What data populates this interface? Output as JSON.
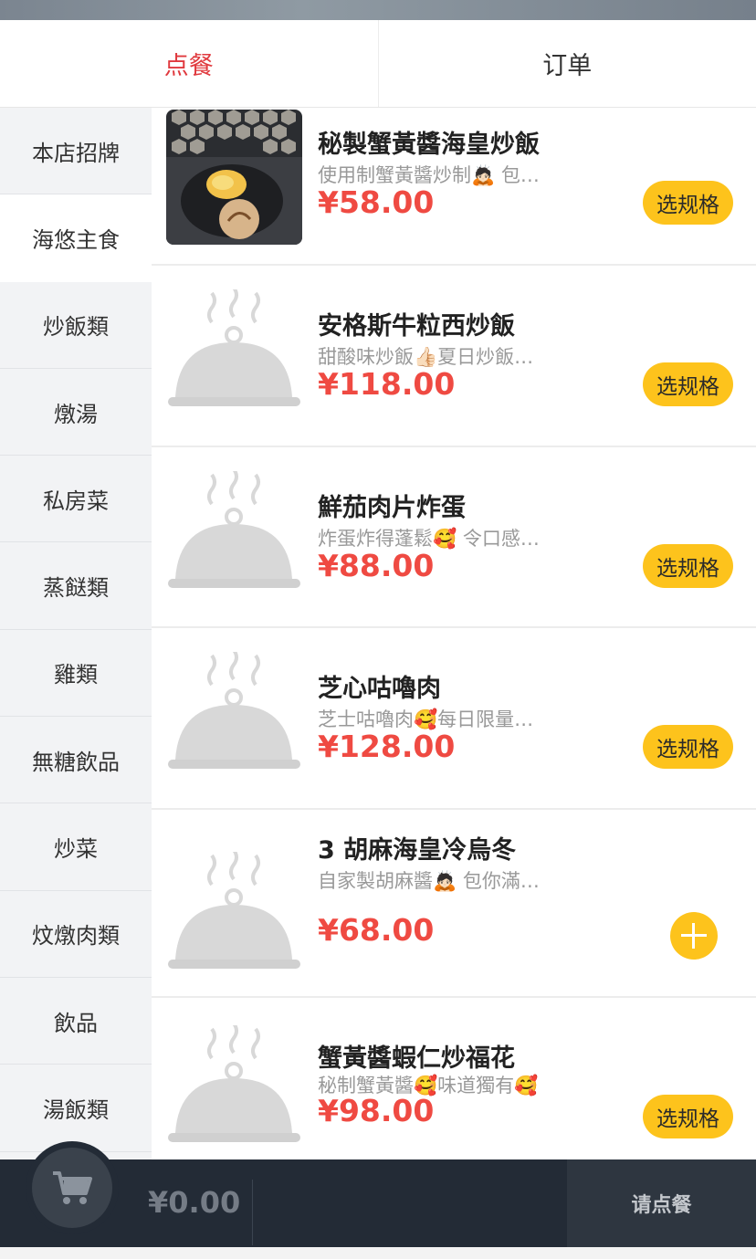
{
  "tabs": [
    {
      "label": "点餐",
      "active": true
    },
    {
      "label": "订单",
      "active": false
    }
  ],
  "sidebar": {
    "items": [
      {
        "label": "本店招牌"
      },
      {
        "label": "海悠主食"
      },
      {
        "label": "炒飯類"
      },
      {
        "label": "燉湯"
      },
      {
        "label": "私房菜"
      },
      {
        "label": "蒸餸類"
      },
      {
        "label": "雞類"
      },
      {
        "label": "無糖飲品"
      },
      {
        "label": "炒菜"
      },
      {
        "label": "炆燉肉類"
      },
      {
        "label": "飲品"
      },
      {
        "label": "湯飯類"
      }
    ],
    "active_index": 1
  },
  "dishes": [
    {
      "name": "秘製蟹黃醬海皇炒飯",
      "desc": "使用制蟹黃醬炒制🙇🏻 包…",
      "price": "¥58.00",
      "action": "选规格",
      "image": "photo"
    },
    {
      "name": "安格斯牛粒西炒飯",
      "desc": "甜酸味炒飯👍🏻夏日炒飯…",
      "price": "¥118.00",
      "action": "选规格",
      "image": "placeholder-cloche-icon"
    },
    {
      "name": "鮮茄肉片炸蛋",
      "desc": "炸蛋炸得蓬鬆🥰 令口感…",
      "price": "¥88.00",
      "action": "选规格",
      "image": "placeholder-cloche-icon"
    },
    {
      "name": "芝心咕嚕肉",
      "desc": "芝士咕嚕肉🥰每日限量…",
      "price": "¥128.00",
      "action": "选规格",
      "image": "placeholder-cloche-icon"
    },
    {
      "name": "3 胡麻海皇冷烏冬",
      "desc": "自家製胡麻醬🙇🏻 包你滿…",
      "price": "¥68.00",
      "action": "+",
      "image": "placeholder-cloche-icon"
    },
    {
      "name": "蟹黃醬蝦仁炒福花",
      "desc": "秘制蟹黃醬🥰味道獨有🥰",
      "price": "¥98.00",
      "action": "选规格",
      "image": "placeholder-cloche-icon"
    }
  ],
  "cart": {
    "total": "¥0.00",
    "icon": "cart-icon",
    "order_label": "请点餐"
  },
  "colors": {
    "accent": "#e0393e",
    "price": "#ef4a42",
    "button": "#fdc31c",
    "bar": "#232b36"
  }
}
